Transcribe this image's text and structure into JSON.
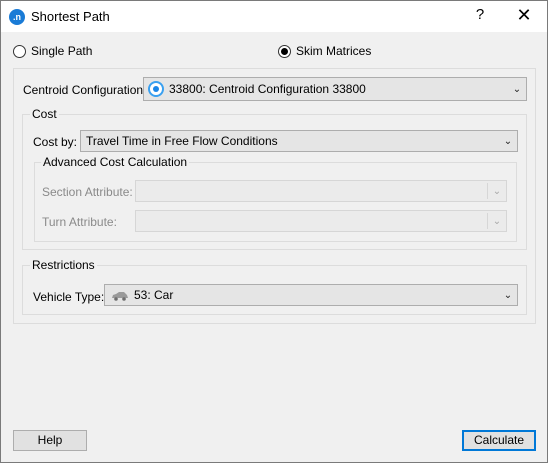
{
  "window": {
    "title": "Shortest Path",
    "help_glyph": "?",
    "close_glyph": "✕",
    "app_icon_text": ".n"
  },
  "mode": {
    "single_path_label": "Single Path",
    "skim_matrices_label": "Skim Matrices",
    "selected": "skim_matrices"
  },
  "centroid": {
    "label": "Centroid Configuration:",
    "value": "33800: Centroid Configuration 33800",
    "icon": "centroid-config-icon"
  },
  "cost": {
    "group_title": "Cost",
    "cost_by_label": "Cost by:",
    "cost_by_value": "Travel Time in Free Flow Conditions",
    "advanced": {
      "group_title": "Advanced Cost Calculation",
      "section_attribute_label": "Section Attribute:",
      "section_attribute_value": "",
      "turn_attribute_label": "Turn Attribute:",
      "turn_attribute_value": ""
    }
  },
  "restrictions": {
    "group_title": "Restrictions",
    "vehicle_type_label": "Vehicle Type:",
    "vehicle_type_value": "53: Car",
    "icon": "car-icon"
  },
  "buttons": {
    "help": "Help",
    "calculate": "Calculate"
  },
  "colors": {
    "accent": "#0078d7",
    "centroid_icon": "#1a86e8"
  }
}
